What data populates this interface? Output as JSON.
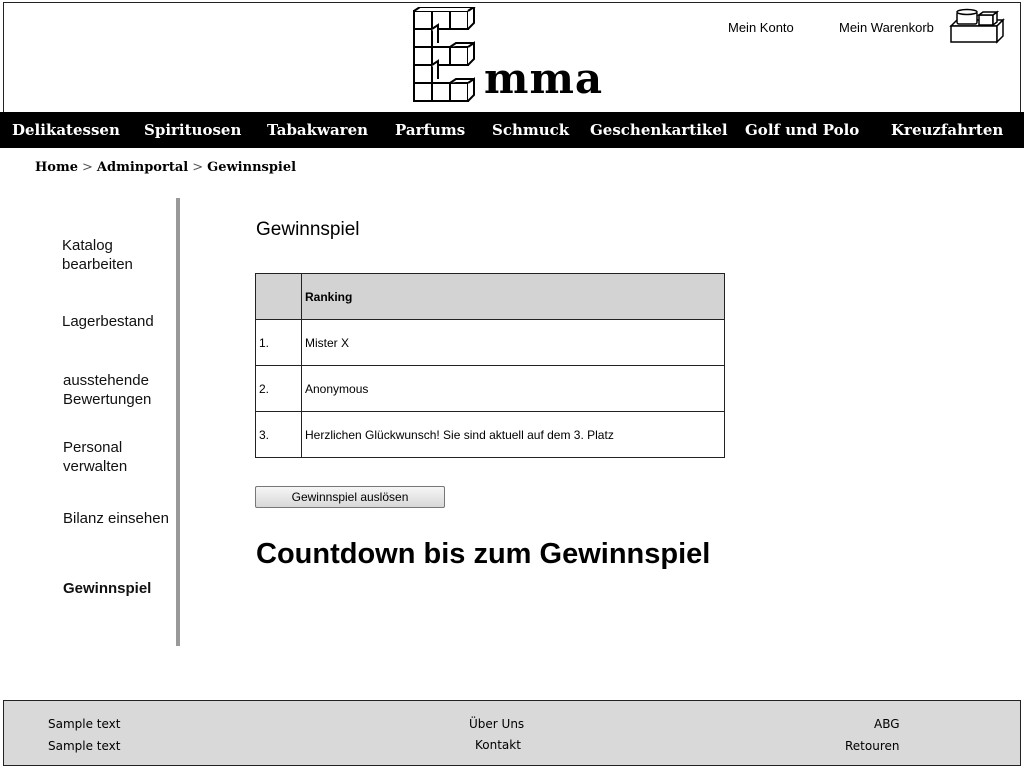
{
  "header": {
    "logo_text": "mma",
    "account_link": "Mein Konto",
    "cart_link": "Mein Warenkorb",
    "cart_icon": "cart-icon"
  },
  "nav": {
    "items": [
      "Delikatessen",
      "Spirituosen",
      "Tabakwaren",
      "Parfums",
      "Schmuck",
      "Geschenkartikel",
      "Golf und Polo",
      "Kreuzfahrten"
    ]
  },
  "breadcrumb": {
    "items": [
      "Home",
      "Adminportal",
      "Gewinnspiel"
    ],
    "separator": ">"
  },
  "sidebar": {
    "items": [
      {
        "label": "Katalog bearbeiten",
        "active": false
      },
      {
        "label": "Lagerbestand",
        "active": false
      },
      {
        "label": "ausstehende Bewertungen",
        "active": false
      },
      {
        "label": "Personal verwalten",
        "active": false
      },
      {
        "label": "Bilanz einsehen",
        "active": false
      },
      {
        "label": "Gewinnspiel",
        "active": true
      }
    ]
  },
  "main": {
    "title": "Gewinnspiel",
    "table": {
      "headers": [
        "",
        "Ranking"
      ],
      "rows": [
        [
          "1.",
          "Mister X"
        ],
        [
          "2.",
          "Anonymous"
        ],
        [
          "3.",
          "Herzlichen Glückwunsch! Sie sind aktuell auf dem 3. Platz"
        ]
      ]
    },
    "draw_button": "Gewinnspiel auslösen",
    "countdown_heading": "Countdown bis zum Gewinnspiel"
  },
  "footer": {
    "left": [
      "Sample text",
      "Sample text"
    ],
    "center": [
      "Über Uns",
      "Kontakt"
    ],
    "right": [
      "ABG",
      "Retouren"
    ]
  },
  "colors": {
    "nav_background": "#000000",
    "nav_text": "#ffffff",
    "table_header_background": "#d3d3d3",
    "footer_background": "#d9d9d9",
    "sidebar_divider": "#999999"
  }
}
